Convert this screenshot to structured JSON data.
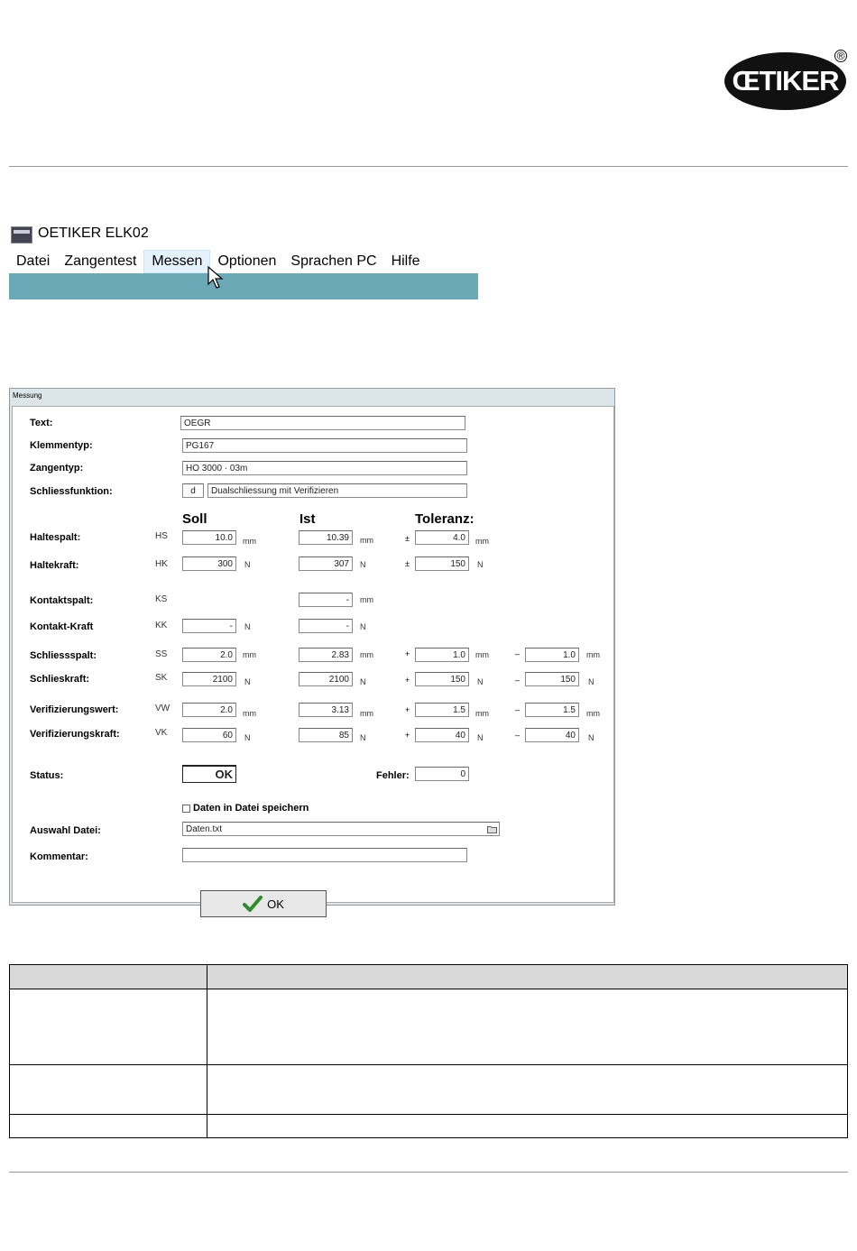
{
  "logo": {
    "text": "ŒTIKER",
    "registered": "®"
  },
  "app": {
    "title": "OETIKER ELK02",
    "menu": [
      "Datei",
      "Zangentest",
      "Messen",
      "Optionen",
      "Sprachen PC",
      "Hilfe"
    ]
  },
  "dialog": {
    "title": "Messung",
    "text_label": "Text:",
    "text_value": "OEGR",
    "clamp_label": "Klemmentyp:",
    "clamp_value": "PG167",
    "tool_label": "Zangentyp:",
    "tool_value": "HO 3000 · 03m",
    "function_label": "Schliessfunktion:",
    "function_code": "d",
    "function_value": "Dualschliessung mit Verifizieren",
    "headers": {
      "soll": "Soll",
      "ist": "Ist",
      "tol": "Toleranz:"
    },
    "rows": {
      "hs": {
        "label": "Haltespalt:",
        "abbr": "HS",
        "soll": "10.0",
        "soll_unit": "mm",
        "ist": "10.39",
        "ist_unit": "mm",
        "tol_sign": "±",
        "tol": "4.0",
        "tol_unit": "mm"
      },
      "hk": {
        "label": "Haltekraft:",
        "abbr": "HK",
        "soll": "300",
        "soll_unit": "N",
        "ist": "307",
        "ist_unit": "N",
        "tol_sign": "±",
        "tol": "150",
        "tol_unit": "N"
      },
      "ks": {
        "label": "Kontaktspalt:",
        "abbr": "KS",
        "ist": "-",
        "ist_unit": "mm"
      },
      "kk": {
        "label": "Kontakt-Kraft",
        "abbr": "KK",
        "soll": "-",
        "soll_unit": "N",
        "ist": "-",
        "ist_unit": "N"
      },
      "ss": {
        "label": "Schliessspalt:",
        "abbr": "SS",
        "soll": "2.0",
        "soll_unit": "mm",
        "ist": "2.83",
        "ist_unit": "mm",
        "plus": "+",
        "tol_plus": "1.0",
        "tol_plus_unit": "mm",
        "minus": "–",
        "tol_minus": "1.0",
        "tol_minus_unit": "mm"
      },
      "sk": {
        "label": "Schlieskraft:",
        "abbr": "SK",
        "soll": "2100",
        "soll_unit": "N",
        "ist": "2100",
        "ist_unit": "N",
        "plus": "+",
        "tol_plus": "150",
        "tol_plus_unit": "N",
        "minus": "–",
        "tol_minus": "150",
        "tol_minus_unit": "N"
      },
      "vw": {
        "label": "Verifizierungswert:",
        "abbr": "VW",
        "soll": "2.0",
        "soll_unit": "mm",
        "ist": "3.13",
        "ist_unit": "mm",
        "plus": "+",
        "tol_plus": "1.5",
        "tol_plus_unit": "mm",
        "minus": "–",
        "tol_minus": "1.5",
        "tol_minus_unit": "mm"
      },
      "vk": {
        "label": "Verifizierungskraft:",
        "abbr": "VK",
        "soll": "60",
        "soll_unit": "N",
        "ist": "85",
        "ist_unit": "N",
        "plus": "+",
        "tol_plus": "40",
        "tol_plus_unit": "N",
        "minus": "–",
        "tol_minus": "40",
        "tol_minus_unit": "N"
      }
    },
    "status_label": "Status:",
    "status_value": "OK",
    "error_label": "Fehler:",
    "error_value": "0",
    "save_label": "Daten in Datei speichern",
    "file_label": "Auswahl Datei:",
    "file_value": "Daten.txt",
    "comment_label": "Kommentar:",
    "comment_value": "",
    "ok_label": "OK"
  }
}
